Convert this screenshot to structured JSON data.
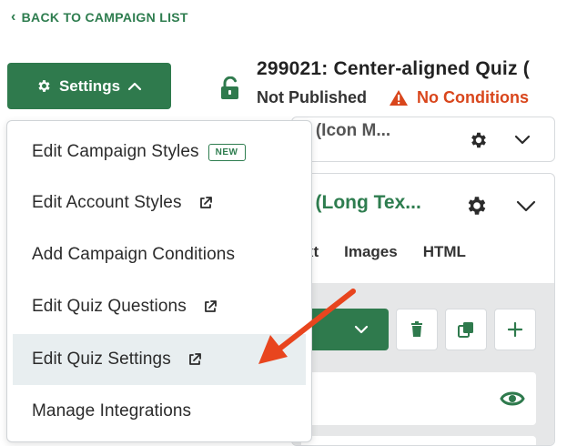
{
  "back_link": {
    "label": "BACK TO CAMPAIGN LIST"
  },
  "settings_button": {
    "label": "Settings"
  },
  "campaign": {
    "title": "299021: Center-aligned Quiz (",
    "status": "Not Published",
    "warning": "No Conditions"
  },
  "panel1": {
    "partial_text": "s (Icon M..."
  },
  "panel2": {
    "partial_title": "s (Long Tex...",
    "tabs": [
      "xt",
      "Images",
      "HTML"
    ]
  },
  "menu": {
    "items": [
      {
        "label": "Edit Campaign Styles",
        "badge": "NEW"
      },
      {
        "label": "Edit Account Styles"
      },
      {
        "label": "Add Campaign Conditions"
      },
      {
        "label": "Edit Quiz Questions"
      },
      {
        "label": "Edit Quiz Settings"
      },
      {
        "label": "Manage Integrations"
      }
    ]
  },
  "colors": {
    "brand_green": "#2f7a4d",
    "warning": "#d9461c",
    "highlight": "#e8eef0",
    "arrow": "#e8451e"
  },
  "icons": [
    "chevron-left-icon",
    "gear-icon",
    "chevron-up-icon",
    "unlock-icon",
    "warning-icon",
    "external-link-icon",
    "chevron-down-icon",
    "trash-icon",
    "copy-icon",
    "plus-icon",
    "eye-icon"
  ]
}
